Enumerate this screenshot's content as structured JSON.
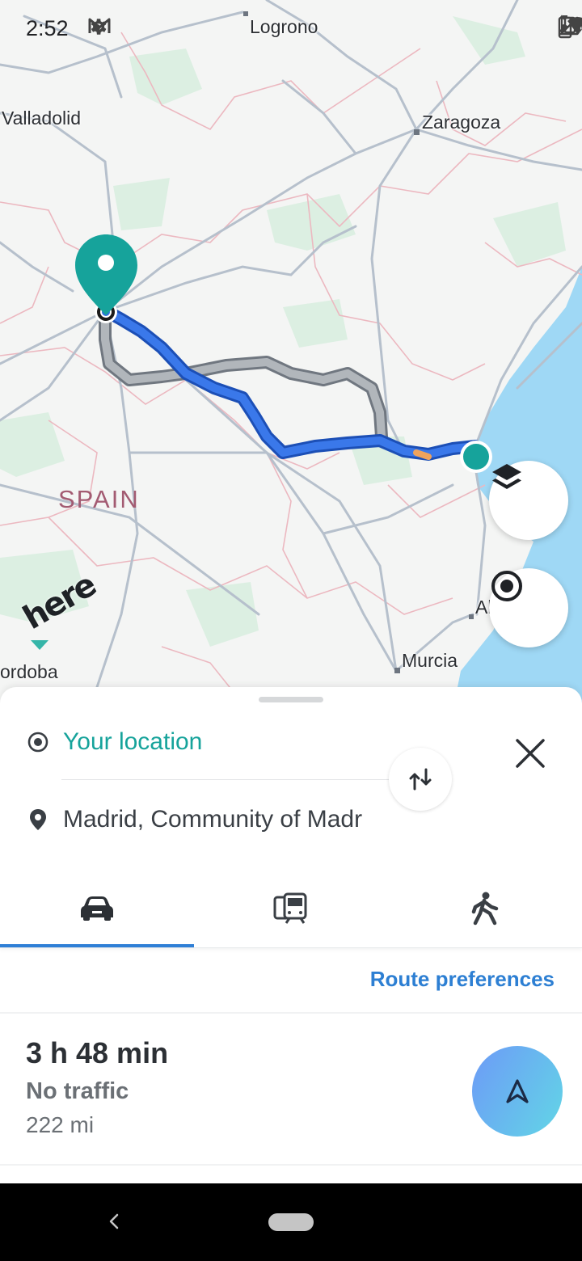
{
  "status_bar": {
    "time": "2:52",
    "left_icons": [
      "settings-gear-icon",
      "gmail-icon",
      "dot-icon"
    ],
    "right_icons": [
      "dot-icon",
      "vibrate-icon",
      "wifi-icon",
      "signal-icon",
      "battery-charging-icon"
    ]
  },
  "map": {
    "cities": [
      {
        "name": "Logrono",
        "id": "logrono"
      },
      {
        "name": "Valladolid",
        "id": "valladolid"
      },
      {
        "name": "Zaragoza",
        "id": "zaragoza"
      },
      {
        "name": "Murcia",
        "id": "murcia"
      },
      {
        "name": "ordoba",
        "id": "cordoba"
      },
      {
        "name": "Al",
        "id": "alicante"
      }
    ],
    "country": "SPAIN",
    "brand": "here",
    "colors": {
      "route_primary": "#2f6fe0",
      "route_alternative": "#8e9499",
      "water": "#9fd8f5",
      "pin": "#16a39b"
    }
  },
  "map_controls": {
    "layers_icon": "layers-icon",
    "locate_icon": "my-location-icon"
  },
  "route_panel": {
    "from": "Your location",
    "to": "Madrid, Community of Madr",
    "swap_icon": "swap-arrows-icon",
    "close_icon": "close-icon",
    "modes": [
      {
        "id": "car",
        "icon": "car-icon",
        "selected": true
      },
      {
        "id": "transit",
        "icon": "transit-icon",
        "selected": false
      },
      {
        "id": "walk",
        "icon": "walk-icon",
        "selected": false
      }
    ],
    "preferences_label": "Route preferences",
    "route": {
      "duration": "3 h 48 min",
      "traffic": "No traffic",
      "distance": "222 mi"
    },
    "go_icon": "navigation-arrow-icon"
  },
  "nav_bar": {
    "back_icon": "back-chevron-icon",
    "home_icon": "home-pill-icon"
  }
}
